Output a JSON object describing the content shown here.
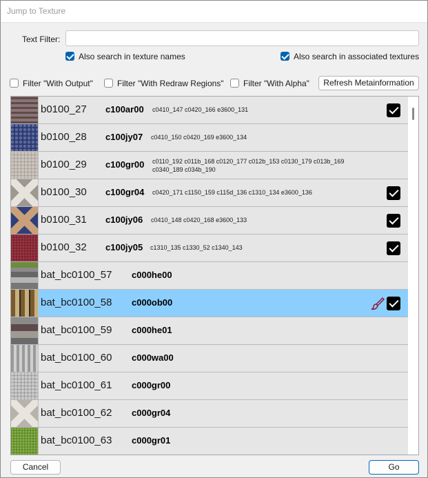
{
  "window": {
    "title": "Jump to Texture"
  },
  "filter": {
    "label": "Text Filter:",
    "value": "",
    "also_names": {
      "label": "Also search in texture names",
      "checked": true
    },
    "also_assoc": {
      "label": "Also search in associated textures",
      "checked": true
    }
  },
  "options": {
    "with_output": "Filter \"With Output\"",
    "with_redraw": "Filter \"With Redraw Regions\"",
    "with_alpha": "Filter \"With Alpha\"",
    "refresh": "Refresh Metainformation"
  },
  "rows": [
    {
      "name": "b0100_27",
      "code": "c100ar00",
      "assoc": "c0410_147 c0420_166 e3600_131",
      "checked": true,
      "thumb": "brick"
    },
    {
      "name": "b0100_28",
      "code": "c100jy07",
      "assoc": "c0410_150 c0420_169 e3600_134",
      "checked": false,
      "thumb": "bluestone"
    },
    {
      "name": "b0100_29",
      "code": "c100gr00",
      "assoc": "c0110_192 c011b_168 c0120_177 c012b_153 c0130_179 c013b_169 c0340_189 c034b_190",
      "checked": false,
      "thumb": "gravel"
    },
    {
      "name": "b0100_30",
      "code": "c100gr04",
      "assoc": "c0420_171 c1150_159 c115d_136 c1310_134 e3600_136",
      "checked": true,
      "thumb": "diamond"
    },
    {
      "name": "b0100_31",
      "code": "c100jy06",
      "assoc": "c0410_148 c0420_168 e3600_133",
      "checked": true,
      "thumb": "ornate"
    },
    {
      "name": "b0100_32",
      "code": "c100jy05",
      "assoc": "c1310_135 c1330_52 c1340_143",
      "checked": true,
      "thumb": "redcarpet"
    },
    {
      "name": "bat_bc0100_57",
      "code": "c000he00",
      "assoc": "",
      "checked": false,
      "thumb": "strip"
    },
    {
      "name": "bat_bc0100_58",
      "code": "c000ob00",
      "assoc": "",
      "checked": true,
      "selected": true,
      "brush": true,
      "thumb": "boxes"
    },
    {
      "name": "bat_bc0100_59",
      "code": "c000he01",
      "assoc": "",
      "checked": false,
      "thumb": "strip2"
    },
    {
      "name": "bat_bc0100_60",
      "code": "c000wa00",
      "assoc": "",
      "checked": false,
      "thumb": "wall"
    },
    {
      "name": "bat_bc0100_61",
      "code": "c000gr00",
      "assoc": "",
      "checked": false,
      "thumb": "gravel2"
    },
    {
      "name": "bat_bc0100_62",
      "code": "c000gr04",
      "assoc": "",
      "checked": false,
      "thumb": "diamond2"
    },
    {
      "name": "bat_bc0100_63",
      "code": "c000gr01",
      "assoc": "",
      "checked": false,
      "thumb": "grass"
    }
  ],
  "footer": {
    "cancel": "Cancel",
    "go": "Go"
  },
  "colors": {
    "accent": "#0063b1",
    "selected_row": "#8ccfff",
    "row_bg": "#e6e6e6",
    "brush": "#8b1a3a"
  }
}
